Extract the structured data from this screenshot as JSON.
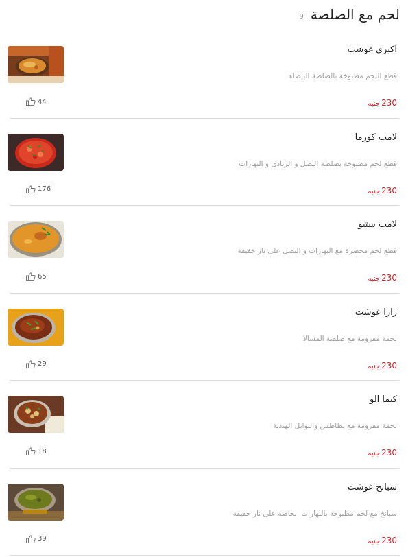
{
  "header": {
    "title": "لحم مع الصلصة",
    "count": "9"
  },
  "items": [
    {
      "name": "اكبري غوشت",
      "description": "قطع اللحم مطبوخة بالصلصة البيضاء",
      "price": "230",
      "currency": "جنيه",
      "likes": "44"
    },
    {
      "name": "لامب كورما",
      "description": "قطع لحم مطبوخة بصلصة البصل و الزبادى و البهارات",
      "price": "230",
      "currency": "جنيه",
      "likes": "176"
    },
    {
      "name": "لامب ستيو",
      "description": "قطع لحم محضرة مع البهارات و البصل على نار خفيفة",
      "price": "230",
      "currency": "جنيه",
      "likes": "65"
    },
    {
      "name": "رارا غوشت",
      "description": "لحمة مفرومة مع صلصة المسالا",
      "price": "230",
      "currency": "جنيه",
      "likes": "29"
    },
    {
      "name": "كيما الو",
      "description": "لحمة مفرومة مع بطاطس والتوابل الهندية",
      "price": "230",
      "currency": "جنيه",
      "likes": "18"
    },
    {
      "name": "سبانخ غوشت",
      "description": "سبانخ مع لحم مطبوخة بالبهارات الخاصة على نار خفيفة",
      "price": "230",
      "currency": "جنيه",
      "likes": "39"
    }
  ],
  "colors": {
    "price": "#d32027",
    "separator": "#dddddd",
    "description": "#9e9e9e"
  },
  "icons": {
    "like": "thumbs-up-icon"
  }
}
